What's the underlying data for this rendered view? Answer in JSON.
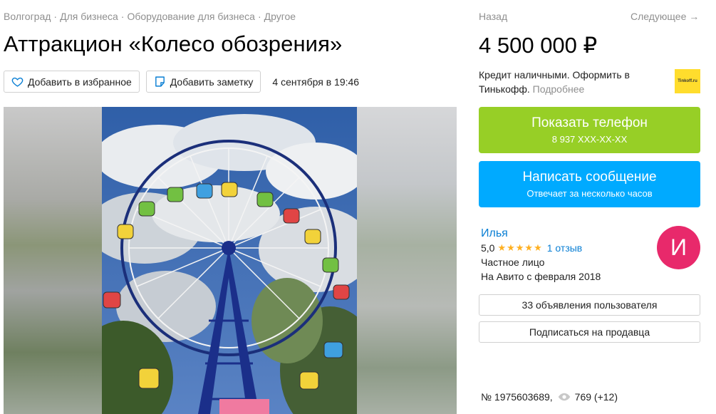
{
  "breadcrumbs": [
    "Волгоград",
    "Для бизнеса",
    "Оборудование для бизнеса",
    "Другое"
  ],
  "breadcrumb_separator": "·",
  "title": "Аттракцион «Колесо обозрения»",
  "actions": {
    "favorite_label": "Добавить в избранное",
    "note_label": "Добавить заметку",
    "date": "4 сентября в 19:46"
  },
  "nav": {
    "back": "Назад",
    "next": "Следующее →"
  },
  "price": "4 500 000 ₽",
  "credit": {
    "text": "Кредит наличными. Оформить в Тинькофф.",
    "more": "Подробнее",
    "logo": "Tinkoff.ru"
  },
  "phone_button": {
    "label": "Показать телефон",
    "number": "8 937 XXX-XX-XX"
  },
  "message_button": {
    "label": "Написать сообщение",
    "sub": "Отвечает за несколько часов"
  },
  "seller": {
    "name": "Илья",
    "rating": "5,0",
    "stars": "★★★★★",
    "reviews": "1 отзыв",
    "type": "Частное лицо",
    "since": "На Авито с февраля 2018",
    "avatar_letter": "И"
  },
  "user_ads_button": "33 объявления пользователя",
  "subscribe_button": "Подписаться на продавца",
  "listing": {
    "number": "№ 1975603689,",
    "views": "769 (+12)"
  },
  "colors": {
    "green": "#97cf26",
    "blue": "#00aaff",
    "link": "#0a7fd4",
    "avatar": "#e8296b",
    "star": "#ffb021"
  }
}
